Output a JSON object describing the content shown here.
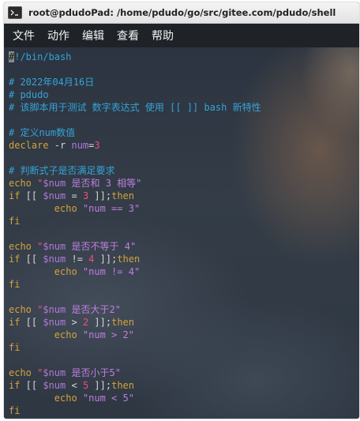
{
  "window": {
    "title": "root@pdudoPad: /home/pdudo/go/src/gitee.com/pdudo/shell"
  },
  "menu": {
    "file": "文件",
    "edit_action": "动作",
    "edit": "编辑",
    "view": "查看",
    "help": "帮助"
  },
  "terminal": {
    "lines": [
      [
        {
          "t": "#",
          "c": "cursor"
        },
        {
          "t": "!/bin/bash",
          "c": "c-comment"
        }
      ],
      [],
      [
        {
          "t": "# 2022年04月16日",
          "c": "c-comment"
        }
      ],
      [
        {
          "t": "# pdudo",
          "c": "c-comment"
        }
      ],
      [
        {
          "t": "# 该脚本用于测试 数字表达式 使用 [[ ]] bash 新特性",
          "c": "c-comment"
        }
      ],
      [],
      [
        {
          "t": "# 定义num数值",
          "c": "c-comment"
        }
      ],
      [
        {
          "t": "declare",
          "c": "c-kw"
        },
        {
          "t": " -r ",
          "c": "c-plain"
        },
        {
          "t": "num",
          "c": "c-var"
        },
        {
          "t": "=",
          "c": "c-plain"
        },
        {
          "t": "3",
          "c": "c-num"
        }
      ],
      [],
      [
        {
          "t": "# 判断式子是否满足要求",
          "c": "c-comment"
        }
      ],
      [
        {
          "t": "echo",
          "c": "c-kw"
        },
        {
          "t": " \"",
          "c": "c-str"
        },
        {
          "t": "$num",
          "c": "c-var"
        },
        {
          "t": " 是否和 3 相等\"",
          "c": "c-str2"
        }
      ],
      [
        {
          "t": "if",
          "c": "c-kw"
        },
        {
          "t": " [[ ",
          "c": "c-plain"
        },
        {
          "t": "$num",
          "c": "c-var"
        },
        {
          "t": " = ",
          "c": "c-plain"
        },
        {
          "t": "3",
          "c": "c-num"
        },
        {
          "t": " ]];",
          "c": "c-plain"
        },
        {
          "t": "then",
          "c": "c-kw"
        }
      ],
      [
        {
          "t": "        echo",
          "c": "c-kw"
        },
        {
          "t": " \"num == 3\"",
          "c": "c-str2"
        }
      ],
      [
        {
          "t": "fi",
          "c": "c-kw"
        }
      ],
      [],
      [
        {
          "t": "echo",
          "c": "c-kw"
        },
        {
          "t": " \"",
          "c": "c-str"
        },
        {
          "t": "$num",
          "c": "c-var"
        },
        {
          "t": " 是否不等于 4\"",
          "c": "c-str2"
        }
      ],
      [
        {
          "t": "if",
          "c": "c-kw"
        },
        {
          "t": " [[ ",
          "c": "c-plain"
        },
        {
          "t": "$num",
          "c": "c-var"
        },
        {
          "t": " != ",
          "c": "c-plain"
        },
        {
          "t": "4",
          "c": "c-num"
        },
        {
          "t": " ]];",
          "c": "c-plain"
        },
        {
          "t": "then",
          "c": "c-kw"
        }
      ],
      [
        {
          "t": "        echo",
          "c": "c-kw"
        },
        {
          "t": " \"num != 4\"",
          "c": "c-str2"
        }
      ],
      [
        {
          "t": "fi",
          "c": "c-kw"
        }
      ],
      [],
      [
        {
          "t": "echo",
          "c": "c-kw"
        },
        {
          "t": " \"",
          "c": "c-str"
        },
        {
          "t": "$num",
          "c": "c-var"
        },
        {
          "t": " 是否大于2\"",
          "c": "c-str2"
        }
      ],
      [
        {
          "t": "if",
          "c": "c-kw"
        },
        {
          "t": " [[ ",
          "c": "c-plain"
        },
        {
          "t": "$num",
          "c": "c-var"
        },
        {
          "t": " > ",
          "c": "c-plain"
        },
        {
          "t": "2",
          "c": "c-num"
        },
        {
          "t": " ]];",
          "c": "c-plain"
        },
        {
          "t": "then",
          "c": "c-kw"
        }
      ],
      [
        {
          "t": "        echo",
          "c": "c-kw"
        },
        {
          "t": " \"num > 2\"",
          "c": "c-str2"
        }
      ],
      [
        {
          "t": "fi",
          "c": "c-kw"
        }
      ],
      [],
      [
        {
          "t": "echo",
          "c": "c-kw"
        },
        {
          "t": " \"",
          "c": "c-str"
        },
        {
          "t": "$num",
          "c": "c-var"
        },
        {
          "t": " 是否小于5\"",
          "c": "c-str2"
        }
      ],
      [
        {
          "t": "if",
          "c": "c-kw"
        },
        {
          "t": " [[ ",
          "c": "c-plain"
        },
        {
          "t": "$num",
          "c": "c-var"
        },
        {
          "t": " < ",
          "c": "c-plain"
        },
        {
          "t": "5",
          "c": "c-num"
        },
        {
          "t": " ]];",
          "c": "c-plain"
        },
        {
          "t": "then",
          "c": "c-kw"
        }
      ],
      [
        {
          "t": "        echo",
          "c": "c-kw"
        },
        {
          "t": " \"num < 5\"",
          "c": "c-str2"
        }
      ],
      [
        {
          "t": "fi",
          "c": "c-kw"
        }
      ]
    ]
  }
}
